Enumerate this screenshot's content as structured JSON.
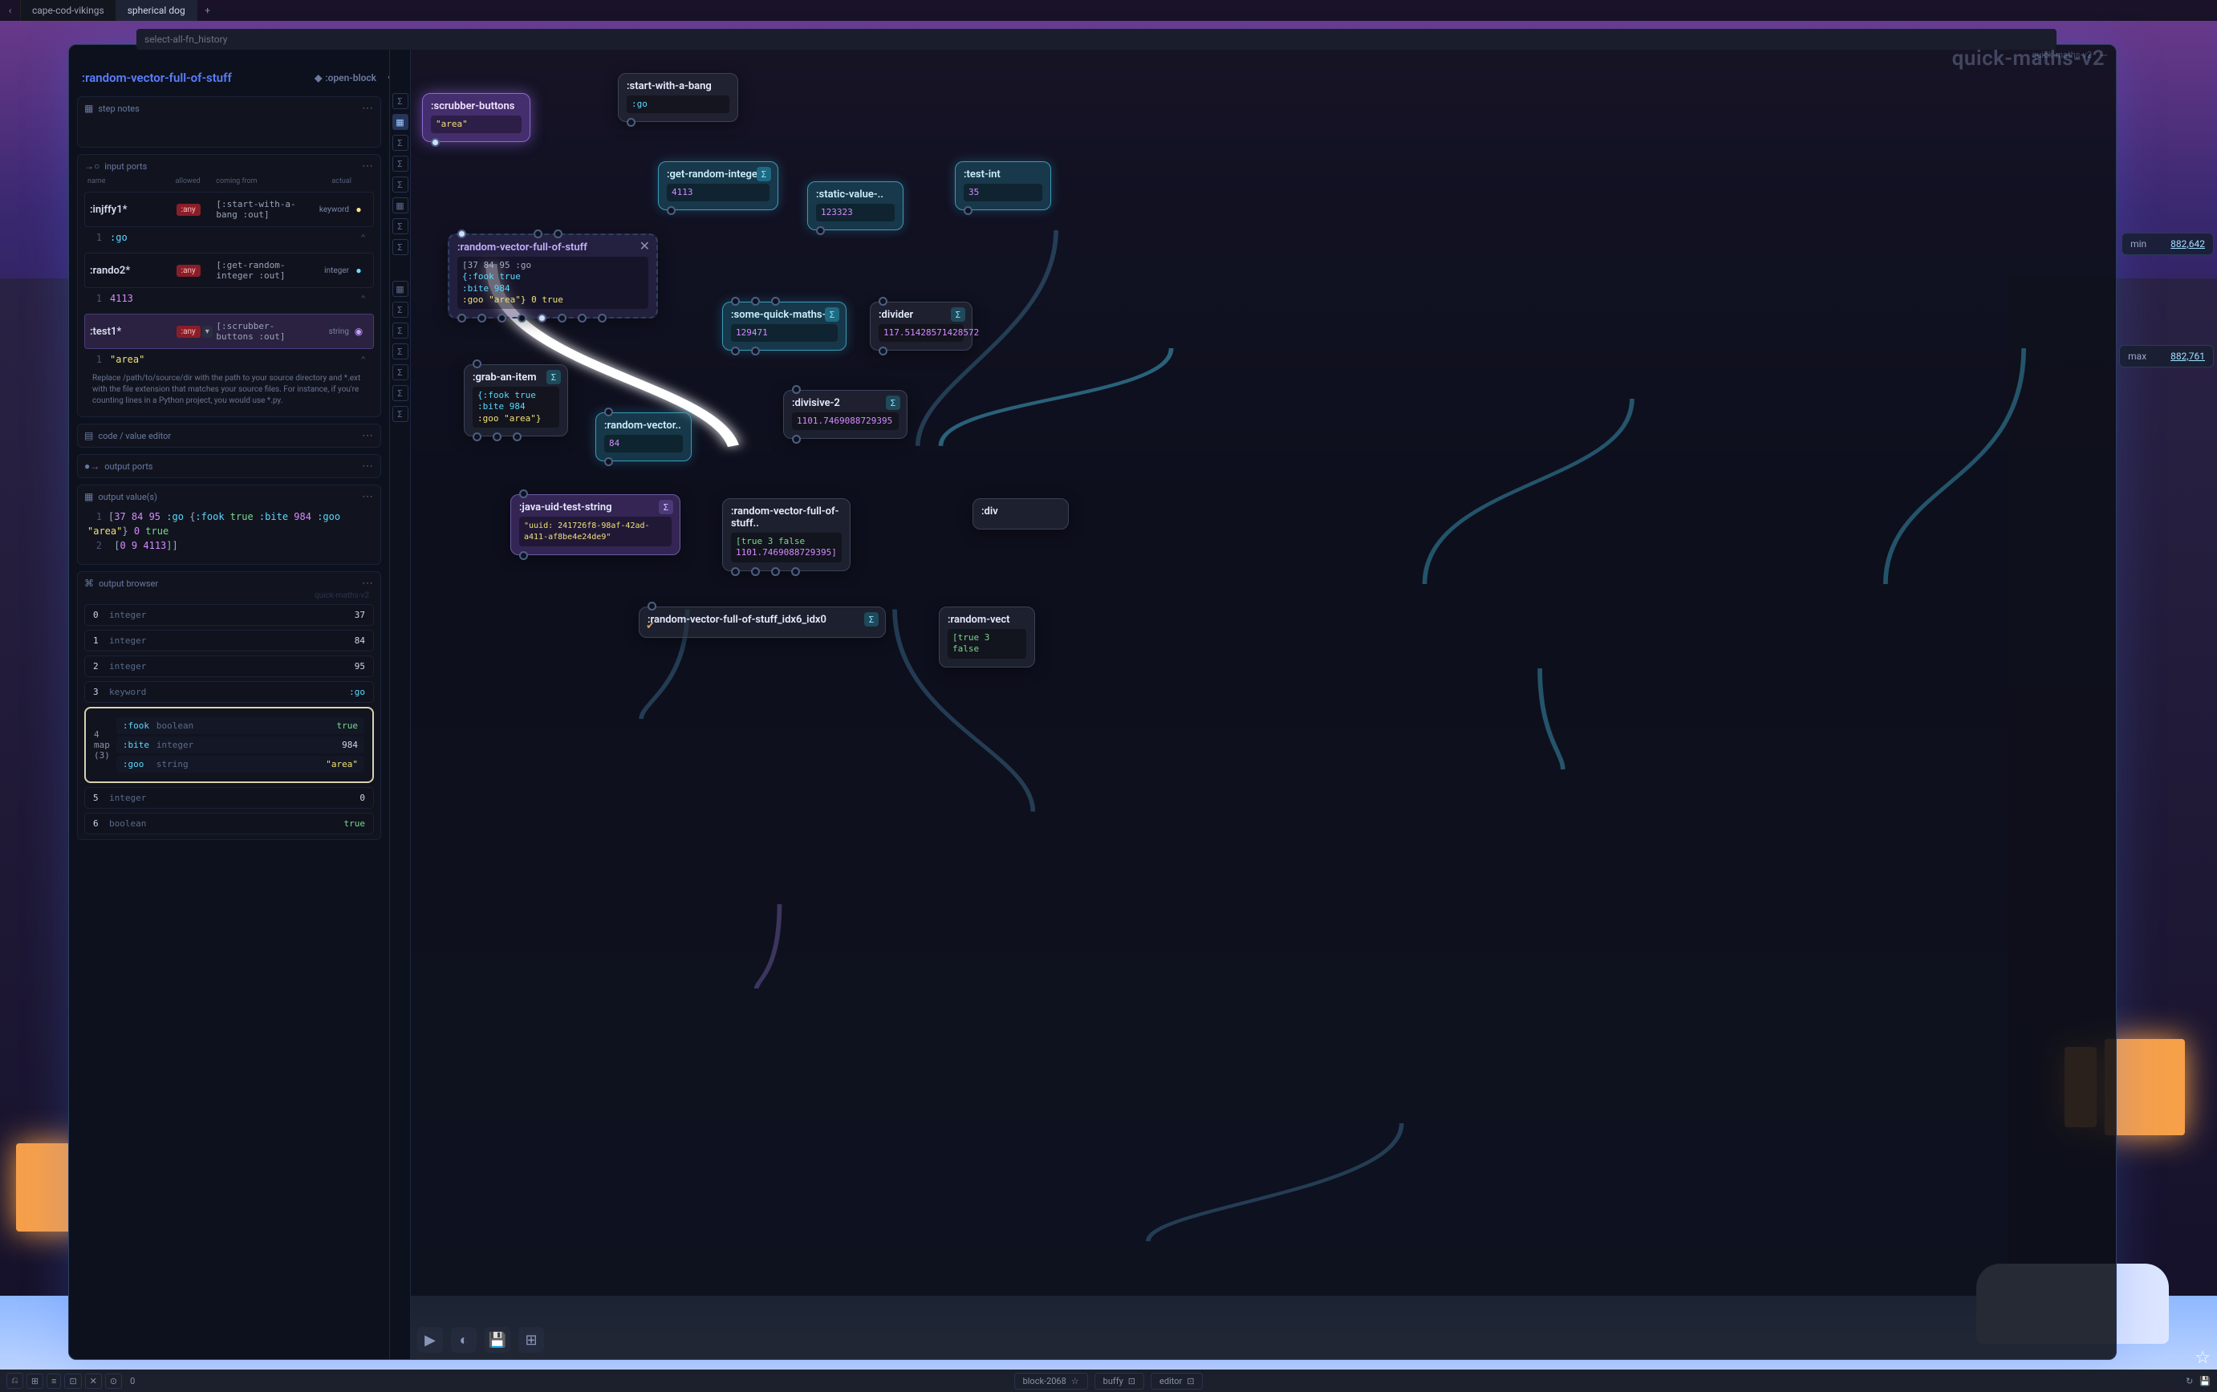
{
  "tabs": {
    "back_glyph": "‹",
    "items": [
      "cape-cod-vikings",
      "spherical dog"
    ],
    "active": 1,
    "add_glyph": "+"
  },
  "search": {
    "placeholder": "select-all-fn_history"
  },
  "window": {
    "handle": "✥",
    "title_right": "quick-maths-v2",
    "close": "—"
  },
  "canvas_title": "quick-maths-v2",
  "inspector": {
    "title": ":random-vector-full-of-stuff",
    "open_block": ":open-block",
    "open_block_icon": "◆",
    "collapse": "‹",
    "step_notes": {
      "icon": "▦",
      "label": "step notes",
      "dots": "⋯"
    },
    "input_ports": {
      "icon": "→○",
      "label": "input ports",
      "dots": "⋯",
      "cols": {
        "name": "name",
        "allowed": "allowed",
        "from": "coming from",
        "actual": "actual"
      },
      "rows": [
        {
          "name": ":injffy1*",
          "chip": ":any",
          "from": "[:start-with-a-bang :out]",
          "type": "keyword",
          "bulb": "●",
          "bulb_cls": "",
          "val_label": ":go",
          "ln": "1"
        },
        {
          "name": ":rando2*",
          "chip": ":any",
          "from": "[:get-random-integer :out]",
          "type": "integer",
          "bulb": "●",
          "bulb_cls": "cyan",
          "val_label": "4113",
          "ln": "1"
        },
        {
          "name": ":test1*",
          "chip": ":any",
          "from": "[:scrubber-buttons :out]",
          "type": "string",
          "bulb": "◉",
          "bulb_cls": "viol",
          "val_label": "\"area\"",
          "ln": "1",
          "sel": true,
          "drop": "▾"
        }
      ],
      "help": "Replace /path/to/source/dir with the path to your source directory and *.ext with the file extension that matches your source files. For instance, if you're counting lines in a Python project, you would use *.py."
    },
    "code_editor": {
      "icon": "▤",
      "label": "code / value editor",
      "dots": "⋯"
    },
    "output_ports": {
      "icon": "●→",
      "label": "output ports",
      "dots": "⋯"
    },
    "output_values": {
      "icon": "▦",
      "label": "output value(s)",
      "dots": "⋯",
      "line1_ln": "1",
      "line1_a": "[",
      "line1_b": "37 84 95",
      "line1_c": ":go",
      "line1_d": "{",
      "line1_e": ":fook",
      "line1_f": "true",
      "line1_g": ":bite",
      "line1_h": "984",
      "line1_i": ":goo",
      "line1_j": "\"area\"",
      "line1_k": "}",
      "line1_l": "0",
      "line1_m": "true",
      "line2_ln": "2",
      "line2_a": "[",
      "line2_b": "0 9 4113",
      "line2_c": "]]"
    },
    "output_browser": {
      "icon": "⌘",
      "label": "output browser",
      "dots": "⋯",
      "watermark": "quick-maths-v2",
      "rows": [
        {
          "idx": "0",
          "typ": "integer",
          "val": "37"
        },
        {
          "idx": "1",
          "typ": "integer",
          "val": "84"
        },
        {
          "idx": "2",
          "typ": "integer",
          "val": "95"
        },
        {
          "idx": "3",
          "typ": "keyword",
          "val": ":go",
          "kw": true
        }
      ],
      "map": {
        "idx": "4",
        "label": "map",
        "count": "(3)",
        "rows": [
          {
            "k": ":fook",
            "t": "boolean",
            "v": "true"
          },
          {
            "k": ":bite",
            "t": "integer",
            "v": "984"
          },
          {
            "k": ":goo",
            "t": "string",
            "v": "\"area\""
          }
        ]
      },
      "tail": [
        {
          "idx": "5",
          "typ": "integer",
          "val": "0"
        },
        {
          "idx": "6",
          "typ": "boolean",
          "val": "true"
        }
      ]
    }
  },
  "rail": {
    "sigma": "Σ",
    "grid": "▦"
  },
  "nodes": {
    "scrubber": {
      "title": ":scrubber-buttons",
      "val": "\"area\""
    },
    "start": {
      "title": ":start-with-a-bang",
      "val": ":go"
    },
    "getrand": {
      "title": ":get-random-integer",
      "val": "4113"
    },
    "static": {
      "title": ":static-value-..",
      "val": "123323"
    },
    "testint": {
      "title": ":test-int",
      "val": "35"
    },
    "rvfs": {
      "title": ":random-vector-full-of-stuff",
      "l1": "[37 84 95 :go",
      "l2": " {:fook true",
      "l3": "  :bite 984",
      "l4": "  :goo \"area\"} 0 true"
    },
    "someqm": {
      "title": ":some-quick-maths-yo",
      "val": "129471"
    },
    "divider": {
      "title": ":divider",
      "val": "117.51428571428572"
    },
    "grab": {
      "title": ":grab-an-item",
      "l1": "{:fook true",
      "l2": " :bite 984",
      "l3": " :goo \"area\"}"
    },
    "rv2": {
      "title": ":random-vector..",
      "val": "84"
    },
    "div2": {
      "title": ":divisive-2",
      "val": "1101.7469088729395"
    },
    "java": {
      "title": ":java-uid-test-string",
      "val": "\"uuid:  241726f8-98af-42ad-a411-af8be4e24de9\""
    },
    "rvfs2": {
      "title": ":random-vector-full-of-stuff..",
      "l1": "[true 3 false",
      "l2": " 1101.7469088729395]"
    },
    "div3": {
      "title": ":div"
    },
    "rvidx": {
      "title": ":random-vector-full-of-stuff_idx6_idx0"
    },
    "rvend": {
      "title": ":random-vect",
      "l1": "[true 3",
      "l2": " false"
    }
  },
  "side": {
    "min": {
      "label": "min",
      "val": "882,642"
    },
    "max": {
      "label": "max",
      "val": "882,761"
    }
  },
  "canvas_tools": {
    "play": "▶",
    "moon": "◐",
    "save": "💾",
    "grid": "⊞"
  },
  "footer": {
    "btns": [
      "⎌",
      "⊞",
      "≡",
      "⊡",
      "✕",
      "⊙"
    ],
    "zero": "0",
    "center": [
      {
        "label": "block-2068",
        "icon": "☆"
      },
      {
        "label": "buffy",
        "icon": "⊡"
      },
      {
        "label": "editor",
        "icon": "⊡"
      }
    ],
    "right": {
      "refresh": "↻",
      "save": "💾"
    }
  },
  "star": "☆"
}
